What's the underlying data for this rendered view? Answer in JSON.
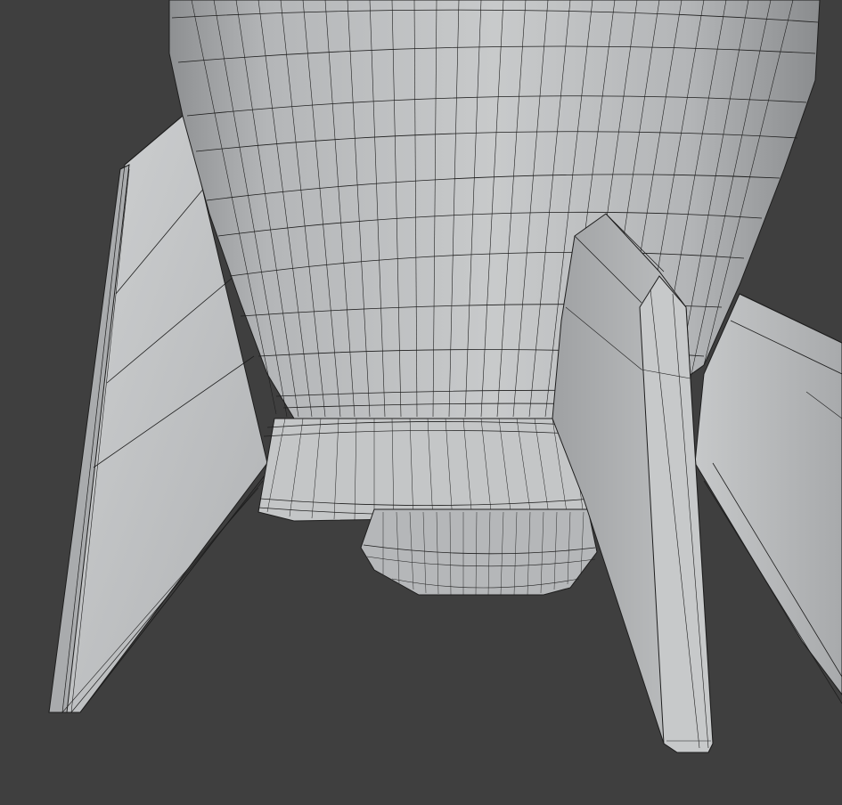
{
  "viewport": {
    "background_color": "#3f3f3f",
    "mesh_base_color": "#b7b9bb",
    "wire_color": "#1a1a1a"
  },
  "objects": {
    "body": "rocket-body-mesh",
    "nozzle": "rocket-nozzle-mesh",
    "fin_left": "left-fin-mesh",
    "fin_front": "front-fin-mesh",
    "fin_right": "right-fin-mesh"
  }
}
